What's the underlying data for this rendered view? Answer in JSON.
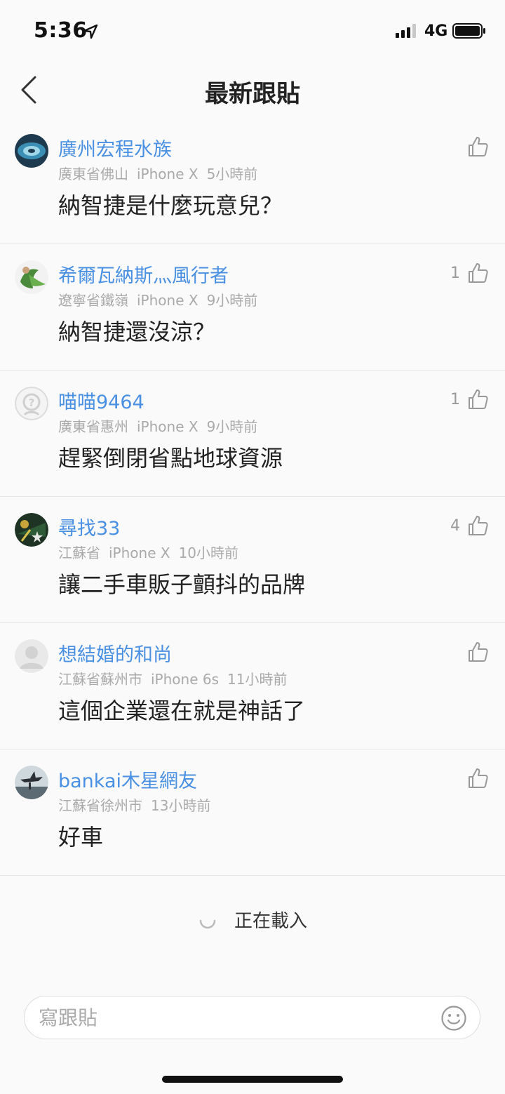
{
  "status_bar": {
    "time": "5:36",
    "network": "4G"
  },
  "header": {
    "title": "最新跟貼"
  },
  "comments": [
    {
      "username": "廣州宏程水族",
      "location": "廣東省佛山",
      "device": "iPhone X",
      "time": "5小時前",
      "content": "納智捷是什麼玩意兒？",
      "likes": ""
    },
    {
      "username": "希爾瓦納斯灬風行者",
      "location": "遼寧省鐵嶺",
      "device": "iPhone X",
      "time": "9小時前",
      "content": "納智捷還沒涼？",
      "likes": "1"
    },
    {
      "username": "喵喵9464",
      "location": "廣東省惠州",
      "device": "iPhone X",
      "time": "9小時前",
      "content": "趕緊倒閉省點地球資源",
      "likes": "1"
    },
    {
      "username": "尋找33",
      "location": "江蘇省",
      "device": "iPhone X",
      "time": "10小時前",
      "content": "讓二手車販子顫抖的品牌",
      "likes": "4"
    },
    {
      "username": "想結婚的和尚",
      "location": "江蘇省蘇州市",
      "device": "iPhone 6s",
      "time": "11小時前",
      "content": "這個企業還在就是神話了",
      "likes": ""
    },
    {
      "username": "bankai木星網友",
      "location": "江蘇省徐州市",
      "device": "",
      "time": "13小時前",
      "content": "好車",
      "likes": ""
    }
  ],
  "loading": {
    "text": "正在載入"
  },
  "composer": {
    "placeholder": "寫跟貼"
  },
  "colors": {
    "username": "#4a90e2",
    "meta": "#aaaaaa"
  }
}
